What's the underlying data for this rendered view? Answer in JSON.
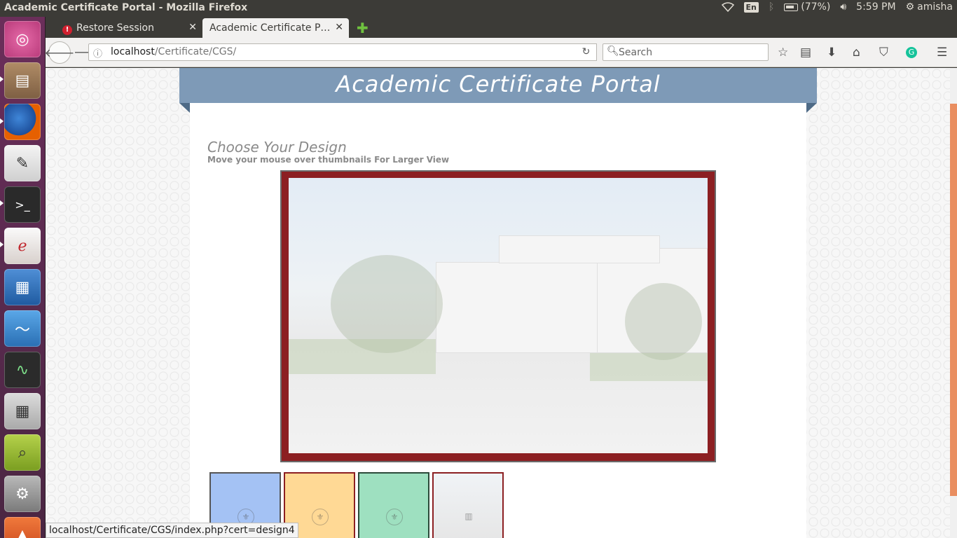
{
  "top_panel": {
    "window_title": "Academic Certificate Portal - Mozilla Firefox",
    "language": "En",
    "battery": "(77%)",
    "time": "5:59 PM",
    "user": "amisha"
  },
  "launcher": {
    "items": [
      {
        "name": "ubuntu-dash",
        "color": "#d9478e"
      },
      {
        "name": "files",
        "color": "#9b7b5b"
      },
      {
        "name": "firefox",
        "color": "#e66000"
      },
      {
        "name": "text-editor",
        "color": "#e8e8e8"
      },
      {
        "name": "terminal",
        "color": "#2c2c2c"
      },
      {
        "name": "document-viewer",
        "color": "#e8e0dc"
      },
      {
        "name": "libreoffice-writer",
        "color": "#2e6db5"
      },
      {
        "name": "system-monitor",
        "color": "#3b83c8"
      },
      {
        "name": "system-monitor-2",
        "color": "#2a2a2a"
      },
      {
        "name": "calculator",
        "color": "#d0d0d0"
      },
      {
        "name": "search-tool",
        "color": "#8ab833"
      },
      {
        "name": "system-settings",
        "color": "#c23c2e"
      },
      {
        "name": "software-center",
        "color": "#e95420"
      }
    ]
  },
  "tabs": [
    {
      "label": "Restore Session",
      "active": false
    },
    {
      "label": "Academic Certificate P…",
      "active": true
    }
  ],
  "navbar": {
    "url_host": "localhost",
    "url_path": "/Certificate/CGS/",
    "search_placeholder": "Search"
  },
  "page": {
    "site_title": "Academic Certificate Portal",
    "heading": "Choose Your Design",
    "subheading": "Move your mouse over thumbnails For Larger View",
    "preview_frame_color": "#8c1f22",
    "thumbnails": [
      {
        "name": "design1",
        "bg": "#a4c2f4",
        "border": "#555555"
      },
      {
        "name": "design2",
        "bg": "#ffd995",
        "border": "#8c1f22"
      },
      {
        "name": "design3",
        "bg": "#9ee0c0",
        "border": "#2c4a3a"
      },
      {
        "name": "design4",
        "bg": "#eeeeee",
        "border": "#8c1f22"
      }
    ]
  },
  "status_bar": {
    "link_url": "localhost/Certificate/CGS/index.php?cert=design4"
  }
}
